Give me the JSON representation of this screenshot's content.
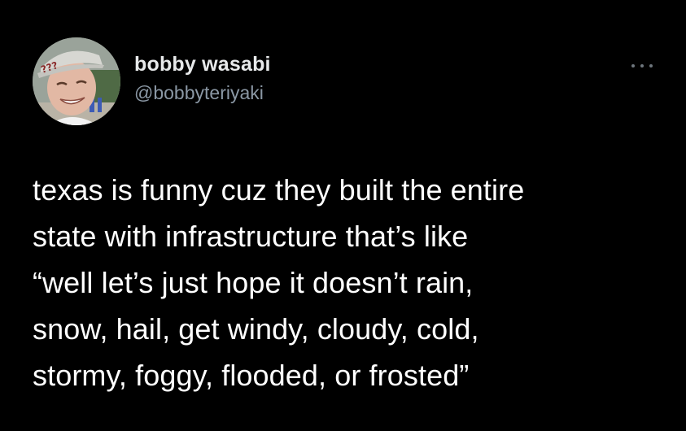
{
  "author": {
    "display_name": "bobby wasabi",
    "handle": "@bobbyteriyaki",
    "avatar_icon": "profile-photo-person-in-cap",
    "avatar_cap_text": "???"
  },
  "menu": {
    "icon": "more-options-icon"
  },
  "tweet": {
    "lines": [
      "texas is funny cuz they built the entire",
      "state with infrastructure that’s like",
      "“well let’s just hope it doesn’t rain,",
      "snow, hail, get windy, cloudy, cold,",
      "stormy, foggy, flooded, or frosted”"
    ]
  },
  "colors": {
    "background": "#000000",
    "name": "#e7e9ea",
    "handle": "#8b98a5",
    "text": "#ffffff"
  }
}
